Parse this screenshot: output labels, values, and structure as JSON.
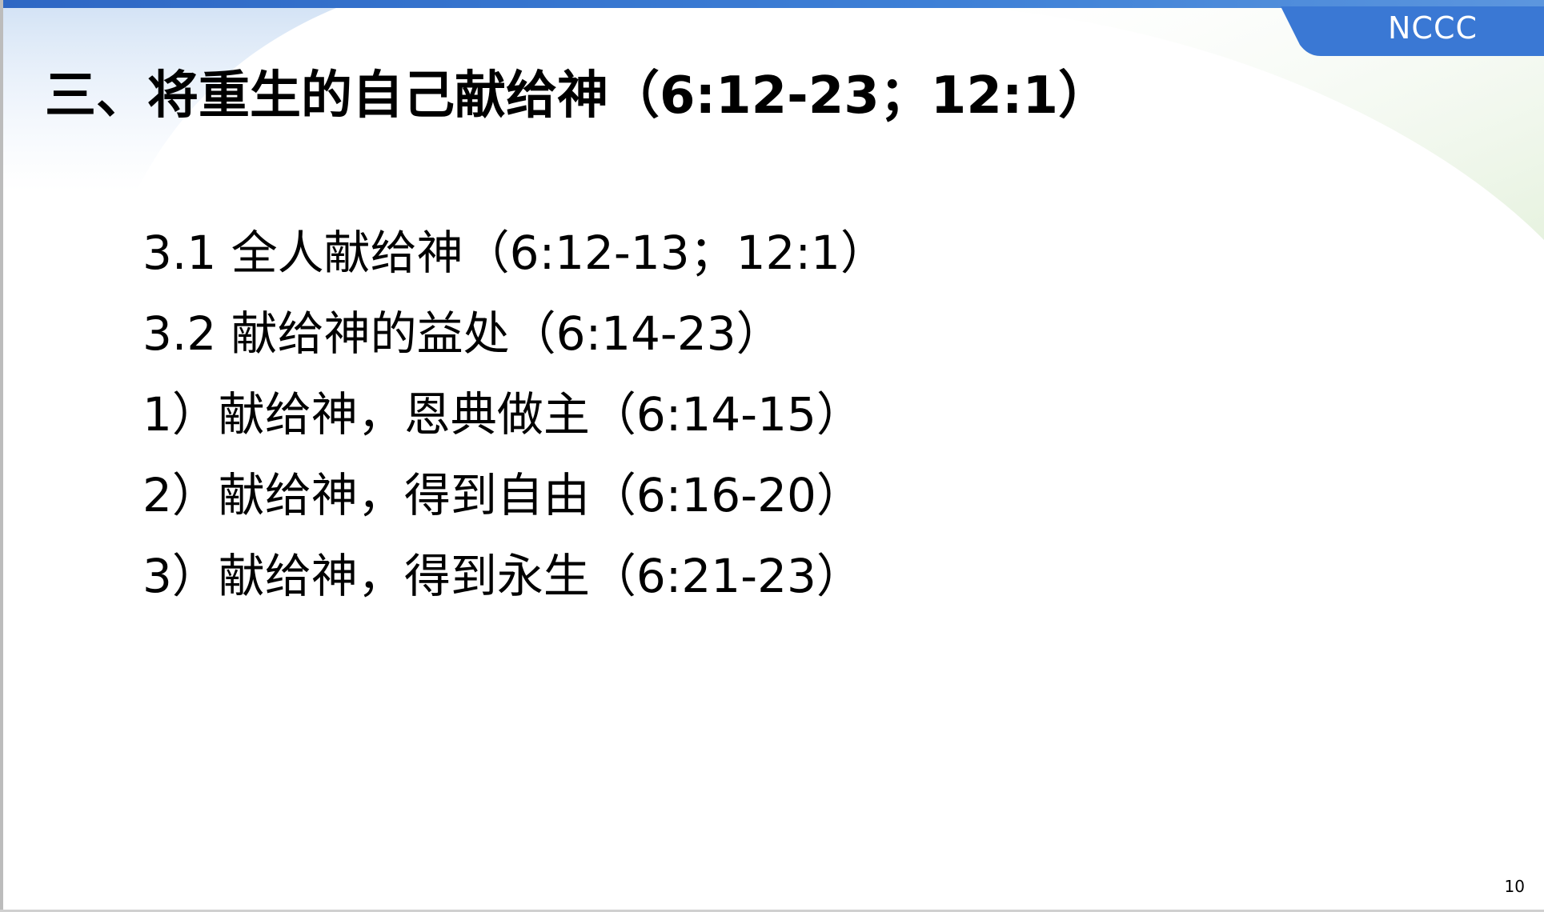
{
  "slide": {
    "brand": "NCCC",
    "title": "三、将重生的自己献给神（6:12-23；12:1）",
    "items": [
      "3.1 全人献给神（6:12-13；12:1）",
      "3.2 献给神的益处（6:14-23）",
      "1）献给神，恩典做主（6:14-15）",
      "2）献给神，得到自由（6:16-20）",
      "3）献给神，得到永生（6:21-23）"
    ],
    "page_number": "10"
  },
  "colors": {
    "accent_blue": "#3a78d4",
    "text": "#000000",
    "background": "#ffffff"
  }
}
